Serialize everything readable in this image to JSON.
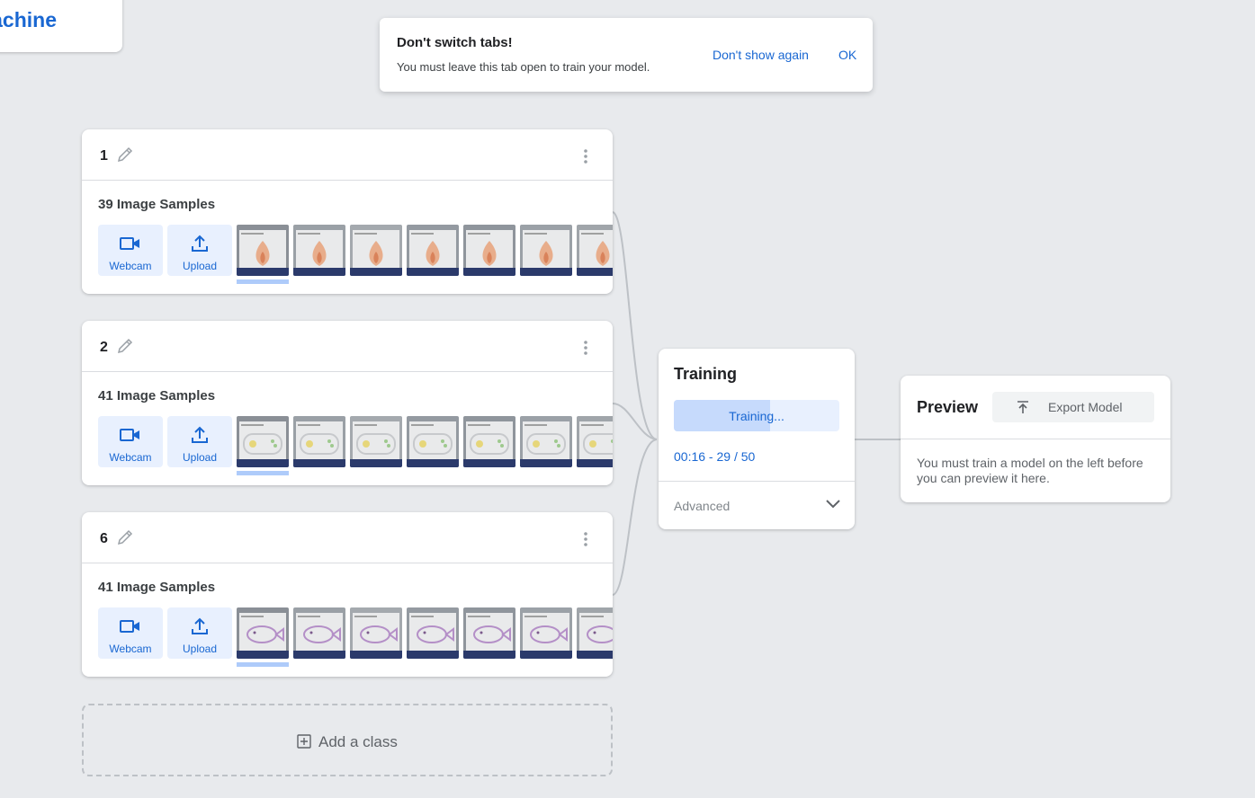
{
  "app": {
    "logo_text": "Teachable Machine"
  },
  "toast": {
    "title": "Don't switch tabs!",
    "message": "You must leave this tab open to train your model.",
    "dont_show_label": "Don't show again",
    "ok_label": "OK"
  },
  "classes": [
    {
      "name": "1",
      "samples_label": "39 Image Samples",
      "webcam_label": "Webcam",
      "upload_label": "Upload",
      "theme": "flame"
    },
    {
      "name": "2",
      "samples_label": "41 Image Samples",
      "webcam_label": "Webcam",
      "upload_label": "Upload",
      "theme": "controller"
    },
    {
      "name": "6",
      "samples_label": "41 Image Samples",
      "webcam_label": "Webcam",
      "upload_label": "Upload",
      "theme": "fish"
    }
  ],
  "add_class": {
    "label": "Add a class"
  },
  "training": {
    "title": "Training",
    "button_label": "Training...",
    "progress_fraction": 0.58,
    "status": "00:16 - 29 / 50",
    "advanced_label": "Advanced"
  },
  "preview": {
    "title": "Preview",
    "export_label": "Export Model",
    "message": "You must train a model on the left before you can preview it here."
  },
  "colors": {
    "accent": "#1967d2",
    "accent_light": "#e8f0fe",
    "background": "#e8eaed"
  },
  "icons": [
    "edit-icon",
    "more-vert-icon",
    "webcam-icon",
    "upload-icon",
    "add-box-icon",
    "chevron-down-icon",
    "export-icon"
  ]
}
